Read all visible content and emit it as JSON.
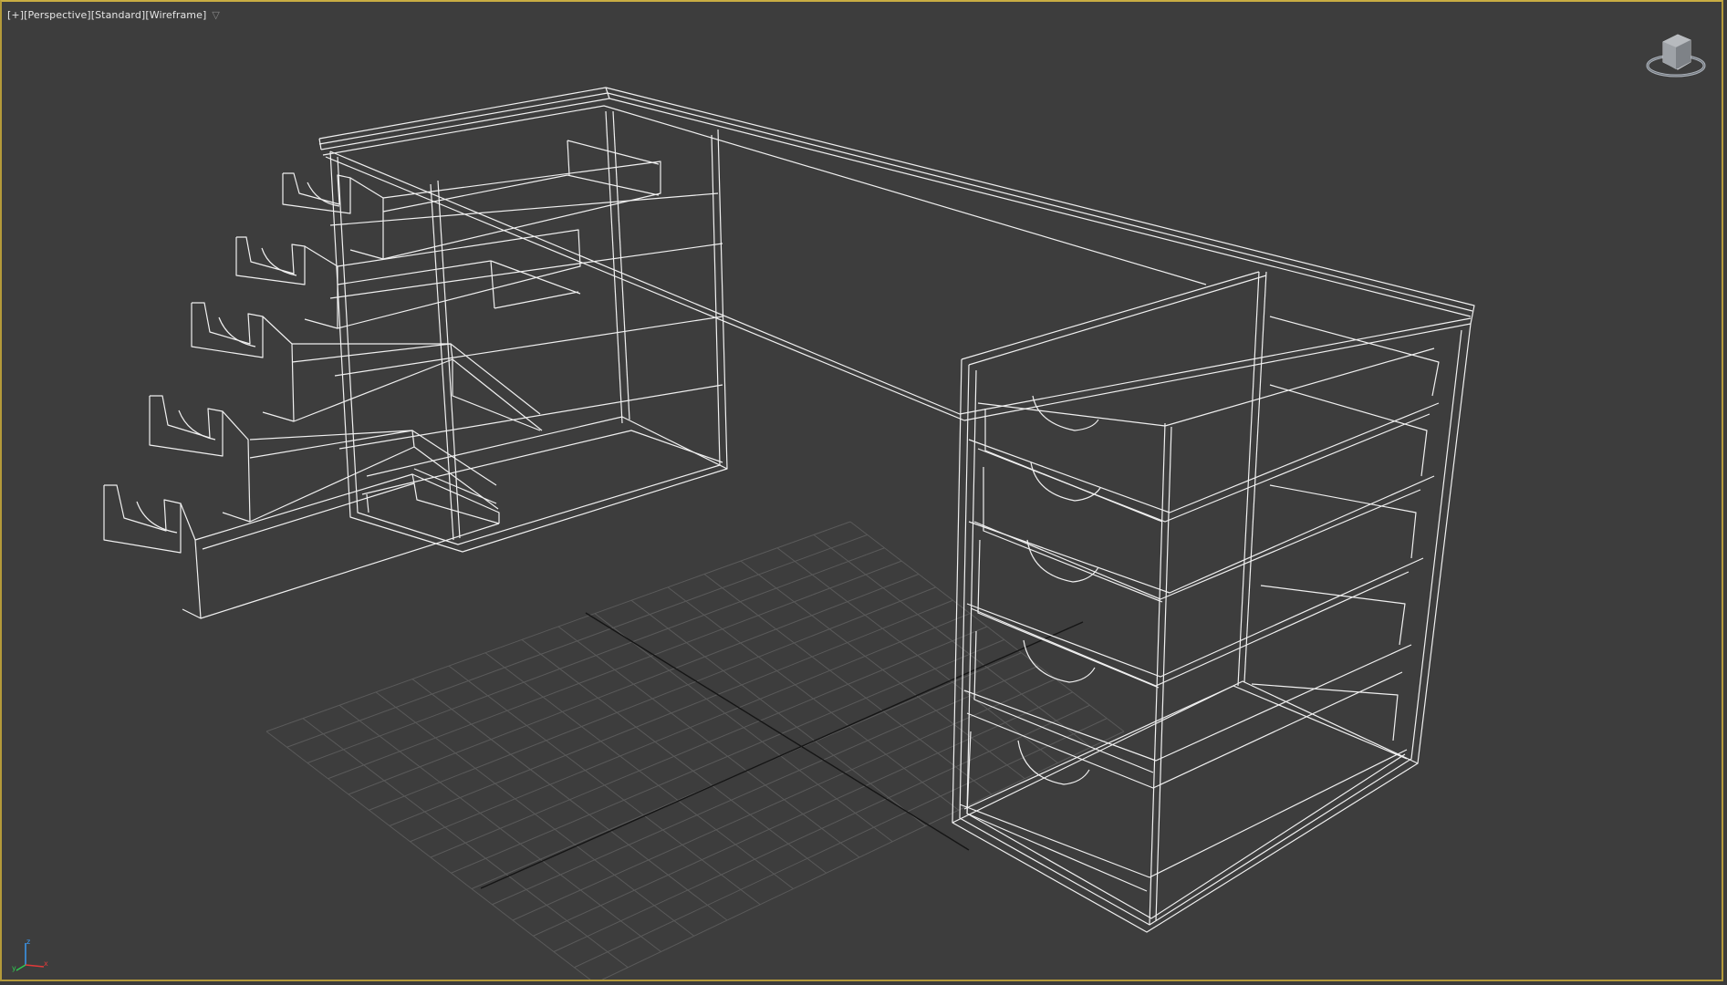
{
  "viewport": {
    "label_plus": "[+]",
    "label_view": "[Perspective]",
    "label_shading_standard": "[Standard]",
    "label_shading_mode": "[Wireframe]",
    "filter_icon": "funnel-icon",
    "border_color": "#c9ad43",
    "background_color": "#3d3d3d",
    "wire_color": "#f2f2f2",
    "grid_color": "#5a5a5a",
    "grid_axis_color": "#111111"
  },
  "viewcube": {
    "icon": "viewcube-icon"
  },
  "axis_tripod": {
    "icon": "axis-tripod-icon",
    "x_label": "x",
    "y_label": "y",
    "z_label": "z"
  }
}
